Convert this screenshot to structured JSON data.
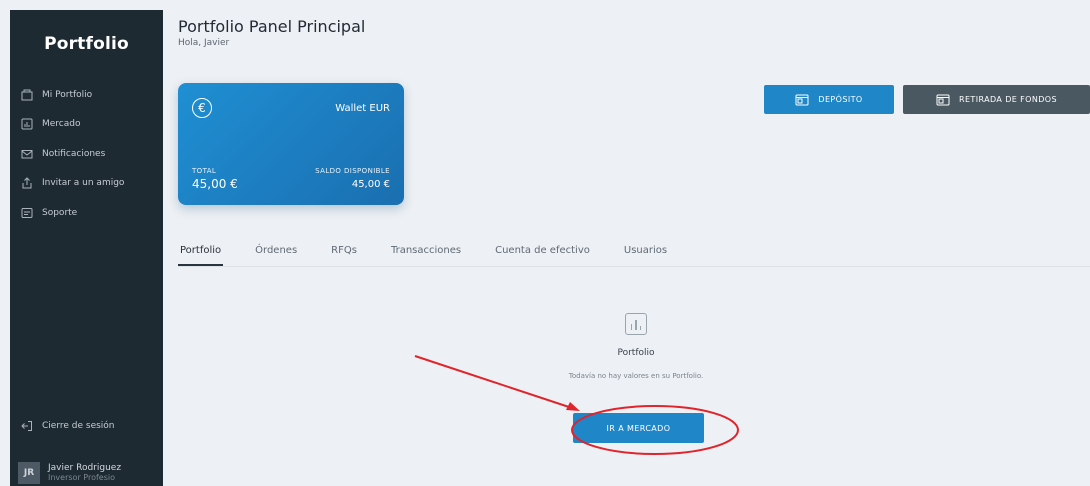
{
  "sidebar": {
    "logo": "Portfolio",
    "items": [
      {
        "label": "Mi Portfolio",
        "icon": "wallet-icon"
      },
      {
        "label": "Mercado",
        "icon": "chart-icon"
      },
      {
        "label": "Notificaciones",
        "icon": "mail-icon"
      },
      {
        "label": "Invitar a un amigo",
        "icon": "share-icon"
      },
      {
        "label": "Soporte",
        "icon": "chat-icon"
      }
    ],
    "logout_label": "Cierre de sesión",
    "user": {
      "initials": "JR",
      "name": "Javier Rodriguez",
      "role": "Inversor Profesio"
    }
  },
  "header": {
    "title": "Portfolio Panel Principal",
    "greeting": "Hola, Javier"
  },
  "wallet": {
    "currency_symbol": "€",
    "name": "Wallet EUR",
    "total_label": "TOTAL",
    "total_value": "45,00 €",
    "available_label": "SALDO DISPONIBLE",
    "available_value": "45,00 €"
  },
  "actions": {
    "deposit_label": "DEPÓSITO",
    "withdraw_label": "RETIRADA DE FONDOS"
  },
  "tabs": [
    {
      "label": "Portfolio",
      "active": true
    },
    {
      "label": "Órdenes",
      "active": false
    },
    {
      "label": "RFQs",
      "active": false
    },
    {
      "label": "Transacciones",
      "active": false
    },
    {
      "label": "Cuenta de efectivo",
      "active": false
    },
    {
      "label": "Usuarios",
      "active": false
    }
  ],
  "empty_state": {
    "icon": "bar-chart-icon",
    "title": "Portfolio",
    "message": "Todavía no hay valores en su Portfolio.",
    "button_label": "IR A MERCADO"
  },
  "colors": {
    "sidebar_bg": "#1e2a32",
    "accent_blue": "#1f87c8",
    "withdraw_bg": "#4a5862",
    "annotation_red": "#e0242b"
  }
}
